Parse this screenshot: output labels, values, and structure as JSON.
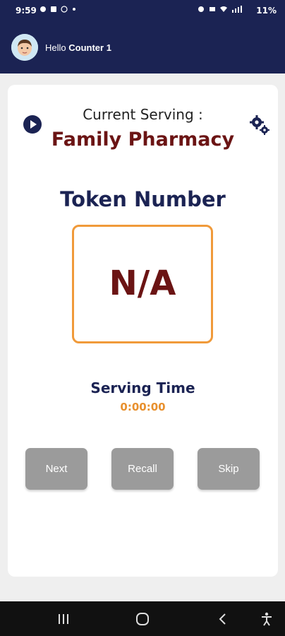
{
  "status_bar": {
    "time": "9:59",
    "battery": "11%",
    "left_icons": [
      "snapchat-icon",
      "linkedin-icon",
      "messenger-icon",
      "dot-icon"
    ],
    "right_icons": [
      "alarm-icon",
      "mute-icon",
      "wifi-icon",
      "signal-icon"
    ]
  },
  "header": {
    "greeting": "Hello",
    "counter_name": "Counter 1",
    "avatar_icon": "avatar-icon"
  },
  "main": {
    "serving_label": "Current Serving :",
    "pharmacy_name": "Family Pharmacy",
    "token_title": "Token Number",
    "token_value": "N/A",
    "serving_time_label": "Serving Time",
    "serving_time_value": "0:00:00"
  },
  "actions": {
    "next": "Next",
    "recall": "Recall",
    "skip": "Skip"
  },
  "icons": {
    "play": "play-icon",
    "settings": "gears-icon"
  },
  "nav_bar": {
    "items": [
      "recent-apps-icon",
      "home-icon",
      "back-icon",
      "accessibility-icon"
    ]
  },
  "colors": {
    "primary": "#1b2353",
    "maroon": "#6b1414",
    "orange": "#f09a3a",
    "button_gray": "#9b9b9b"
  }
}
